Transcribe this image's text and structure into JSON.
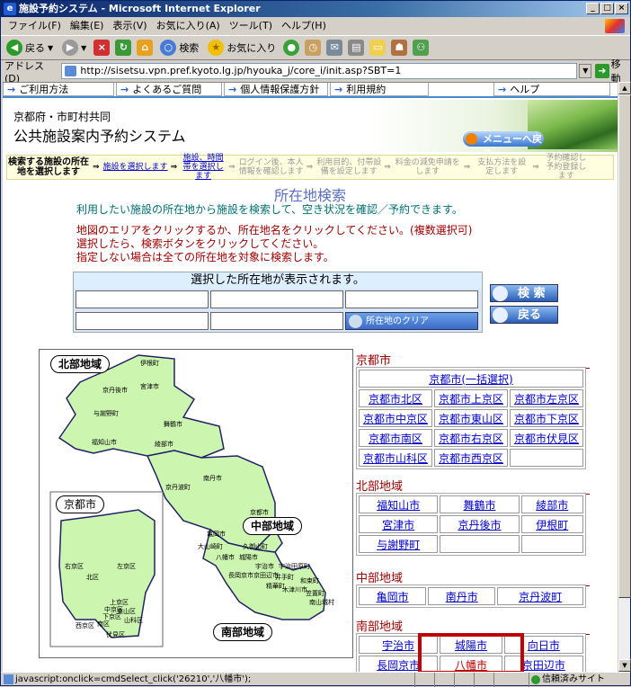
{
  "window": {
    "title": "施設予約システム - Microsoft Internet Explorer",
    "buttons": [
      "_",
      "□",
      "×"
    ]
  },
  "menubar": [
    "ファイル(F)",
    "編集(E)",
    "表示(V)",
    "お気に入り(A)",
    "ツール(T)",
    "ヘルプ(H)"
  ],
  "toolbar": {
    "back": "戻る",
    "search": "検索",
    "favorites": "お気に入り"
  },
  "address": {
    "label": "アドレス(D)",
    "url": "http://sisetsu.vpn.pref.kyoto.lg.jp/hyouka_j/core_i/init.asp?SBT=1",
    "go": "移動"
  },
  "nav_links": [
    "ご利用方法",
    "よくあるご質問",
    "個人情報保護方針",
    "利用規約",
    "ヘルプ"
  ],
  "header": {
    "org": "京都府・市町村共同",
    "system": "公共施設案内予約システム",
    "menu_back": "メニューへ戻る"
  },
  "steps": {
    "current": "検索する施設の所在地を選択します",
    "items": [
      "施設を選択します",
      "施設、時間帯を選択します",
      "ログイン後、本人情報を確認します",
      "利用目的、付帯設備を設定します",
      "料金の減免申請をします",
      "支払方法を設定します",
      "予約確認し予約登録します"
    ]
  },
  "page": {
    "title": "所在地検索",
    "subtitle": "利用したい施設の所在地から施設を検索して、空き状況を確認／予約できます。",
    "instructions": [
      "地図のエリアをクリックするか、所在地名をクリックしてください。(複数選択可)",
      "選択したら、検索ボタンをクリックしてください。",
      "指定しない場合は全ての所在地を対象に検索します。"
    ]
  },
  "selection": {
    "caption": "選択した所在地が表示されます。",
    "clear": "所在地のクリア",
    "search": "検 索",
    "back": "戻る"
  },
  "map": {
    "regions": [
      "北部地域",
      "中部地域",
      "南部地域",
      "京都市"
    ],
    "north_places": [
      "伊根町",
      "宮津市",
      "京丹後市",
      "与謝野町",
      "舞鶴市",
      "福知山市",
      "綾部市"
    ],
    "middle_places": [
      "京丹波町",
      "南丹市",
      "亀岡市"
    ],
    "south_places": [
      "京都市",
      "長岡京市",
      "大山崎町",
      "八幡市",
      "久御山町",
      "城陽市",
      "宇治市",
      "宇治田原町",
      "京田辺市",
      "井手町",
      "和束町",
      "精華町",
      "木津川市",
      "笠置町",
      "南山城村"
    ],
    "kyoto_wards": [
      "右京区",
      "北区",
      "左京区",
      "上京区",
      "中京区",
      "下京区",
      "東山区",
      "山科区",
      "西京区",
      "南区",
      "伏見区"
    ]
  },
  "areas": {
    "kyoto": {
      "heading": "京都市",
      "all": "京都市(一括選択)",
      "rows": [
        [
          "京都市北区",
          "京都市上京区",
          "京都市左京区"
        ],
        [
          "京都市中京区",
          "京都市東山区",
          "京都市下京区"
        ],
        [
          "京都市南区",
          "京都市右京区",
          "京都市伏見区"
        ],
        [
          "京都市山科区",
          "京都市西京区",
          ""
        ]
      ]
    },
    "north": {
      "heading": "北部地域",
      "rows": [
        [
          "福知山市",
          "舞鶴市",
          "綾部市"
        ],
        [
          "宮津市",
          "京丹後市",
          "伊根町"
        ],
        [
          "与謝野町",
          "",
          ""
        ]
      ]
    },
    "middle": {
      "heading": "中部地域",
      "rows": [
        [
          "亀岡市",
          "南丹市",
          "京丹波町"
        ]
      ]
    },
    "south": {
      "heading": "南部地域",
      "rows": [
        [
          "宇治市",
          "城陽市",
          "向日市"
        ],
        [
          "長岡京市",
          "八幡市",
          "京田辺市"
        ]
      ]
    }
  },
  "status": {
    "text": "javascript:onclick=cmdSelect_click('26210','八幡市');",
    "zone": "信頼済みサイト"
  }
}
